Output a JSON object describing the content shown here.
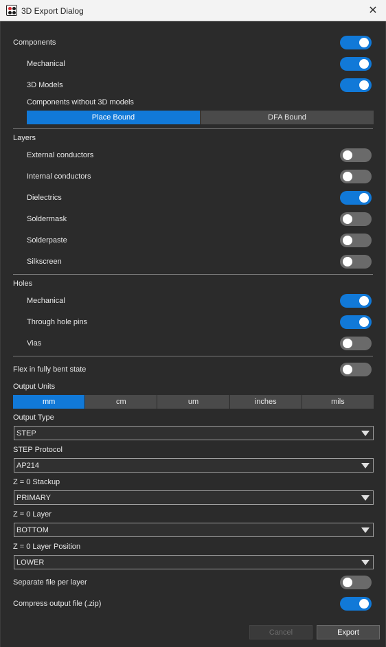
{
  "window": {
    "title": "3D Export Dialog"
  },
  "components": {
    "label": "Components",
    "on": true,
    "mechanical": {
      "label": "Mechanical",
      "on": true
    },
    "models": {
      "label": "3D Models",
      "on": true
    },
    "without_models": {
      "label": "Components without 3D models",
      "options": [
        "Place Bound",
        "DFA Bound"
      ],
      "selected": "Place Bound"
    }
  },
  "layers": {
    "label": "Layers",
    "items": [
      {
        "label": "External conductors",
        "on": false
      },
      {
        "label": "Internal conductors",
        "on": false
      },
      {
        "label": "Dielectrics",
        "on": true
      },
      {
        "label": "Soldermask",
        "on": false
      },
      {
        "label": "Solderpaste",
        "on": false
      },
      {
        "label": "Silkscreen",
        "on": false
      }
    ]
  },
  "holes": {
    "label": "Holes",
    "items": [
      {
        "label": "Mechanical",
        "on": true
      },
      {
        "label": "Through hole pins",
        "on": true
      },
      {
        "label": "Vias",
        "on": false
      }
    ]
  },
  "flex": {
    "label": "Flex in fully bent state",
    "on": false
  },
  "output_units": {
    "label": "Output Units",
    "options": [
      "mm",
      "cm",
      "um",
      "inches",
      "mils"
    ],
    "selected": "mm"
  },
  "output_type": {
    "label": "Output Type",
    "value": "STEP"
  },
  "step_protocol": {
    "label": "STEP Protocol",
    "value": "AP214"
  },
  "z_stackup": {
    "label": "Z = 0 Stackup",
    "value": "PRIMARY"
  },
  "z_layer": {
    "label": "Z = 0 Layer",
    "value": "BOTTOM"
  },
  "z_layer_position": {
    "label": "Z = 0 Layer Position",
    "value": "LOWER"
  },
  "separate_file": {
    "label": "Separate file per layer",
    "on": false
  },
  "compress": {
    "label": "Compress output file (.zip)",
    "on": true
  },
  "buttons": {
    "cancel": "Cancel",
    "export": "Export"
  },
  "colors": {
    "accent": "#1179d8",
    "toggle_off": "#6a6a6a",
    "background": "#2b2b2b"
  }
}
